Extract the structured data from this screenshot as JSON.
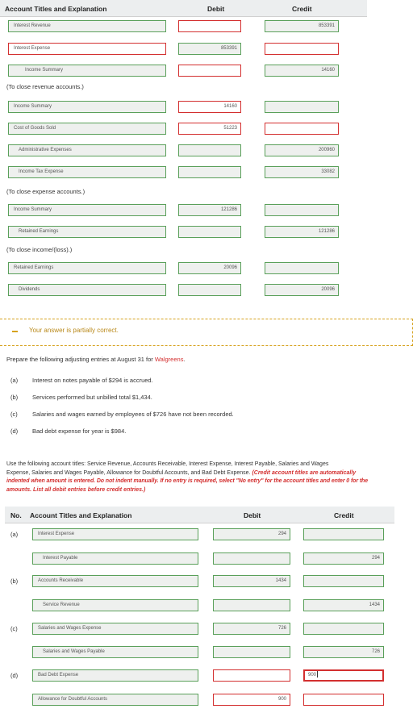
{
  "top_table": {
    "headers": {
      "account": "Account Titles and Explanation",
      "debit": "Debit",
      "credit": "Credit"
    },
    "rows": [
      {
        "account": "Interest Revenue",
        "debit": "",
        "credit": "853391"
      },
      {
        "account": "Interest Expense",
        "debit": "853391",
        "credit": ""
      },
      {
        "account": "Income Summary",
        "debit": "",
        "credit": "14160"
      },
      {
        "account": "Income Summary",
        "debit": "14160",
        "credit": ""
      },
      {
        "account": "Cost of Goods Sold",
        "debit": "51223",
        "credit": ""
      },
      {
        "account": "Administrative Expenses",
        "debit": "",
        "credit": "200960"
      },
      {
        "account": "Income Tax Expense",
        "debit": "",
        "credit": "33082"
      },
      {
        "account": "Income Summary",
        "debit": "121286",
        "credit": ""
      },
      {
        "account": "Retained Earnings",
        "debit": "",
        "credit": "121286"
      },
      {
        "account": "Retained Earnings",
        "debit": "20096",
        "credit": ""
      },
      {
        "account": "Dividends",
        "debit": "",
        "credit": "20096"
      }
    ],
    "notes": [
      "(To close revenue accounts.)",
      "(To close expense accounts.)",
      "(To close income/(loss).)"
    ]
  },
  "feedback": {
    "message": "Your answer is partially correct."
  },
  "prompt": {
    "prefix": "Prepare the following adjusting entries at August 31 for ",
    "company": "Walgreens",
    "suffix": "."
  },
  "items": [
    {
      "label": "(a)",
      "text": "Interest on notes payable of $294 is accrued."
    },
    {
      "label": "(b)",
      "text": "Services performed but unbilled total $1,434."
    },
    {
      "label": "(c)",
      "text": "Salaries and wages earned by employees of $726 have not been recorded."
    },
    {
      "label": "(d)",
      "text": "Bad debt expense for year is $984."
    }
  ],
  "instructions": {
    "line1": "Use the following account titles: Service Revenue, Accounts Receivable, Interest Expense, Interest Payable, Salaries and Wages",
    "line2_plain": "Expense, Salaries and Wages Payable, Allowance for Doubtful Accounts, and Bad Debt Expense. ",
    "line2_red": "(Credit account titles are automatically",
    "line3": "indented when amount is entered. Do not indent manually. If no entry is required, select \"No entry\" for the account titles and enter 0 for the",
    "line4": "amounts. List all debit entries before credit entries.)"
  },
  "bottom_table": {
    "headers": {
      "no": "No.",
      "account": "Account Titles and Explanation",
      "debit": "Debit",
      "credit": "Credit"
    },
    "rows": [
      {
        "no": "(a)",
        "account": "Interest Expense",
        "debit": "294",
        "credit": ""
      },
      {
        "no": "",
        "account": "Interest Payable",
        "debit": "",
        "credit": "294"
      },
      {
        "no": "(b)",
        "account": "Accounts Receivable",
        "debit": "1434",
        "credit": ""
      },
      {
        "no": "",
        "account": "Service Revenue",
        "debit": "",
        "credit": "1434"
      },
      {
        "no": "(c)",
        "account": "Salaries and Wages Expense",
        "debit": "726",
        "credit": ""
      },
      {
        "no": "",
        "account": "Salaries and Wages Payable",
        "debit": "",
        "credit": "726"
      },
      {
        "no": "(d)",
        "account": "Bad Debt Expense",
        "debit": "",
        "credit": "900"
      },
      {
        "no": "",
        "account": "Allowance for Doubtful Accounts",
        "debit": "900",
        "credit": ""
      }
    ]
  },
  "colors": {
    "correct": "#5aa05a",
    "incorrect": "#d32f2f",
    "warning": "#d6a21e"
  }
}
